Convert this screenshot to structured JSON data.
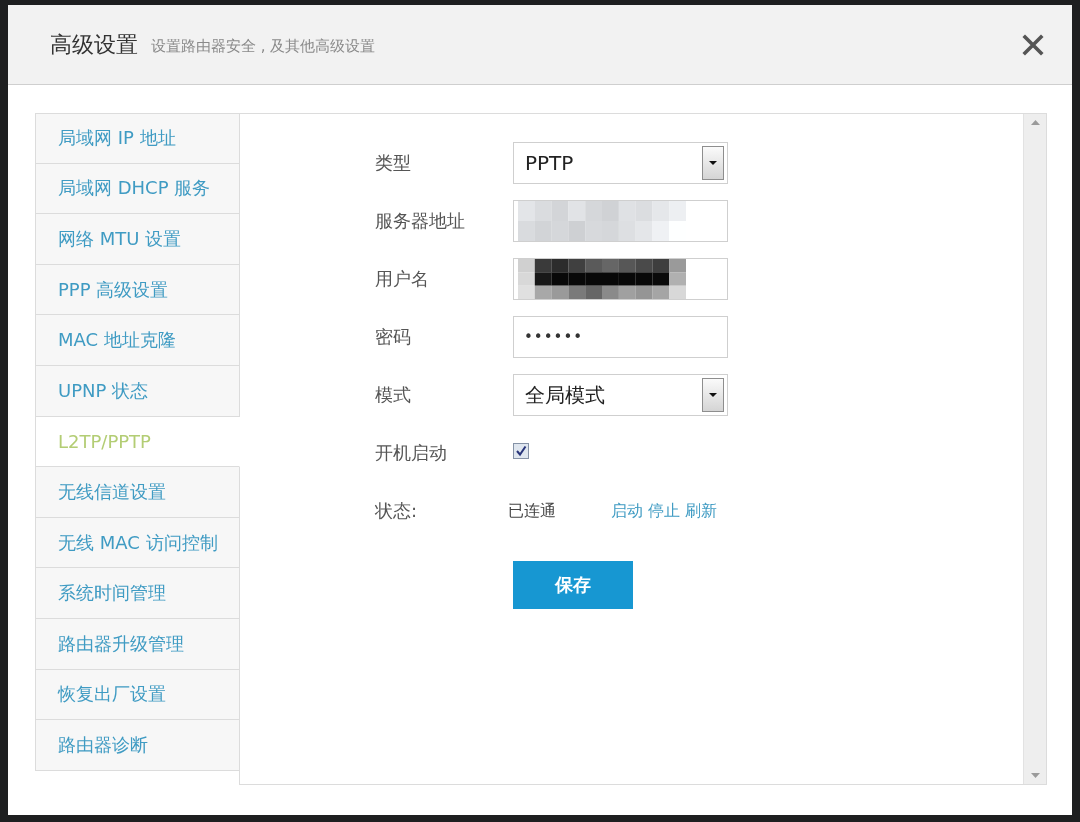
{
  "dialog": {
    "title": "高级设置",
    "subtitle": "设置路由器安全 , 及其他高级设置"
  },
  "sidebar": {
    "items": [
      {
        "label": "局域网 IP 地址",
        "selected": false
      },
      {
        "label": "局域网 DHCP 服务",
        "selected": false
      },
      {
        "label": "网络 MTU 设置",
        "selected": false
      },
      {
        "label": "PPP 高级设置",
        "selected": false
      },
      {
        "label": "MAC 地址克隆",
        "selected": false
      },
      {
        "label": "UPNP 状态",
        "selected": false
      },
      {
        "label": "L2TP/PPTP",
        "selected": true
      },
      {
        "label": "无线信道设置",
        "selected": false
      },
      {
        "label": "无线 MAC 访问控制",
        "selected": false
      },
      {
        "label": "系统时间管理",
        "selected": false
      },
      {
        "label": "路由器升级管理",
        "selected": false
      },
      {
        "label": "恢复出厂设置",
        "selected": false
      },
      {
        "label": "路由器诊断",
        "selected": false
      }
    ]
  },
  "form": {
    "fields": [
      {
        "kind": "select",
        "label": "类型",
        "value": "PPTP"
      },
      {
        "kind": "text",
        "label": "服务器地址",
        "redacted": true,
        "color": "#d5d7da"
      },
      {
        "kind": "text",
        "label": "用户名",
        "redacted": true,
        "color": "#080808"
      },
      {
        "kind": "password",
        "label": "密码",
        "value": "••••••"
      },
      {
        "kind": "select",
        "label": "模式",
        "value": "全局模式"
      },
      {
        "kind": "checkbox",
        "label": "开机启动",
        "checked": true
      },
      {
        "kind": "status",
        "label": "状态:",
        "value": "已连通",
        "links": [
          "启动",
          "停止",
          "刷新"
        ]
      }
    ],
    "save_button": "保存"
  }
}
